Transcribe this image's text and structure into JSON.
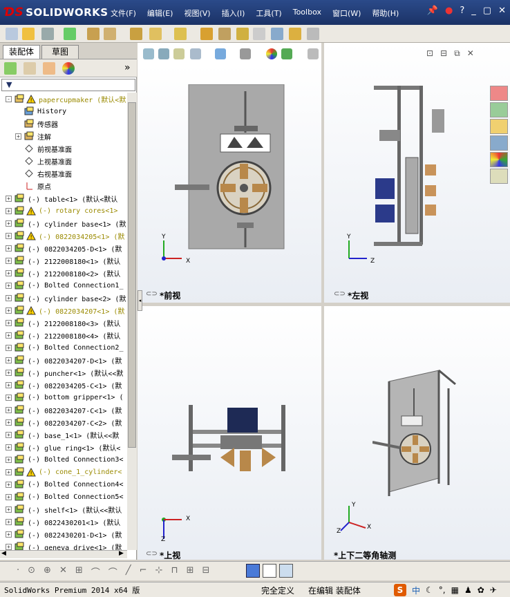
{
  "app": {
    "logo": "SOLIDWORKS"
  },
  "menu": [
    "文件(F)",
    "编辑(E)",
    "视图(V)",
    "插入(I)",
    "工具(T)",
    "Toolbox",
    "窗口(W)",
    "帮助(H)"
  ],
  "panel_tabs": {
    "assembly": "装配体",
    "sketch": "草图"
  },
  "tree": [
    {
      "label": "papercupmaker  (默认<默",
      "icon": "assembly-icon",
      "warn": true,
      "yellow": true,
      "exp": "-",
      "indent": 0
    },
    {
      "label": "History",
      "icon": "history-icon",
      "indent": 1
    },
    {
      "label": "传感器",
      "icon": "sensor-icon",
      "indent": 1
    },
    {
      "label": "注解",
      "icon": "annotation-icon",
      "indent": 1,
      "exp": "+"
    },
    {
      "label": "前视基准面",
      "icon": "plane-icon",
      "indent": 1
    },
    {
      "label": "上视基准面",
      "icon": "plane-icon",
      "indent": 1
    },
    {
      "label": "右视基准面",
      "icon": "plane-icon",
      "indent": 1
    },
    {
      "label": "原点",
      "icon": "origin-icon",
      "indent": 1
    },
    {
      "label": "(-) table<1> (默认<默认",
      "icon": "part-icon",
      "exp": "+"
    },
    {
      "label": "(-) rotary cores<1>",
      "icon": "subassembly-icon",
      "warn": true,
      "yellow": true,
      "exp": "+"
    },
    {
      "label": "(-) cylinder base<1> (默",
      "icon": "part-icon",
      "exp": "+"
    },
    {
      "label": "(-) 0822034205<1> (默",
      "icon": "subassembly-icon",
      "warn": true,
      "yellow": true,
      "exp": "+"
    },
    {
      "label": "(-) 0822034205-D<1> (默",
      "icon": "part-icon",
      "exp": "+"
    },
    {
      "label": "(-) 2122008180<1> (默认",
      "icon": "part-icon",
      "exp": "+"
    },
    {
      "label": "(-) 2122008180<2> (默认",
      "icon": "part-icon",
      "exp": "+"
    },
    {
      "label": "(-) Bolted Connection1_",
      "icon": "part-icon",
      "exp": "+"
    },
    {
      "label": "(-) cylinder base<2> (默",
      "icon": "part-icon",
      "exp": "+"
    },
    {
      "label": "(-) 0822034207<1> (默",
      "icon": "subassembly-icon",
      "warn": true,
      "yellow": true,
      "exp": "+"
    },
    {
      "label": "(-) 2122008180<3> (默认",
      "icon": "part-icon",
      "exp": "+"
    },
    {
      "label": "(-) 2122008180<4> (默认",
      "icon": "part-icon",
      "exp": "+"
    },
    {
      "label": "(-) Bolted Connection2_",
      "icon": "part-icon",
      "exp": "+"
    },
    {
      "label": "(-) 0822034207-D<1> (默",
      "icon": "part-icon",
      "exp": "+"
    },
    {
      "label": "(-) puncher<1> (默认<<默",
      "icon": "part-icon",
      "exp": "+"
    },
    {
      "label": "(-) 0822034205-C<1> (默",
      "icon": "part-icon",
      "exp": "+"
    },
    {
      "label": "(-) bottom gripper<1> (",
      "icon": "part-icon",
      "exp": "+"
    },
    {
      "label": "(-) 0822034207-C<1> (默",
      "icon": "part-icon",
      "exp": "+"
    },
    {
      "label": "(-) 0822034207-C<2> (默",
      "icon": "part-icon",
      "exp": "+"
    },
    {
      "label": "(-) base_1<1> (默认<<默",
      "icon": "part-icon",
      "exp": "+"
    },
    {
      "label": "(-) glue ring<1> (默认<",
      "icon": "part-icon",
      "exp": "+"
    },
    {
      "label": "(-) Bolted Connection3<",
      "icon": "part-icon",
      "exp": "+"
    },
    {
      "label": "(-) cone_1_cylinder<",
      "icon": "subassembly-icon",
      "warn": true,
      "yellow": true,
      "exp": "+"
    },
    {
      "label": "(-) Bolted Connection4<",
      "icon": "part-icon",
      "exp": "+"
    },
    {
      "label": "(-) Bolted Connection5<",
      "icon": "part-icon",
      "exp": "+"
    },
    {
      "label": "(-) shelf<1> (默认<<默认",
      "icon": "part-icon",
      "exp": "+"
    },
    {
      "label": "(-) 0822430201<1> (默认",
      "icon": "part-icon",
      "exp": "+"
    },
    {
      "label": "(-) 0822430201-D<1> (默",
      "icon": "part-icon",
      "exp": "+"
    },
    {
      "label": "(-) geneva drive<1> (默",
      "icon": "part-icon",
      "exp": "+"
    }
  ],
  "views": {
    "front": "*前视",
    "left": "*左视",
    "top": "*上视",
    "iso": "*上下二等角轴测"
  },
  "axes": {
    "x": "X",
    "y": "Y",
    "z": "Z"
  },
  "status": {
    "product": "SolidWorks Premium 2014 x64 版",
    "defined": "完全定义",
    "editing": "在编辑 装配体",
    "ime": "中"
  },
  "colors": {
    "title_bg": "#1b3266",
    "accent": "#e05a00"
  }
}
